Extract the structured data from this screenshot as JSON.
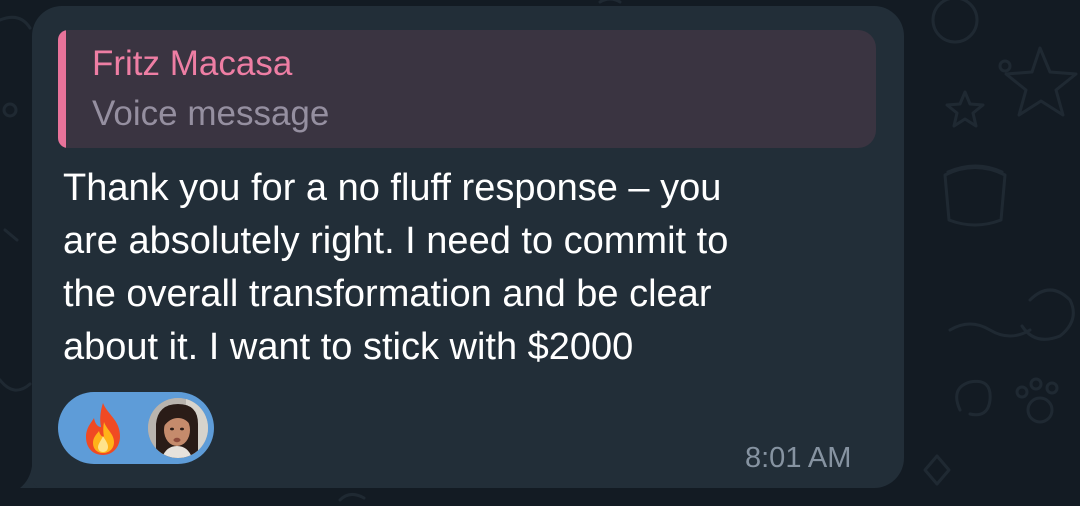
{
  "reply": {
    "sender_name": "Fritz Macasa",
    "quoted_text": "Voice message",
    "accent_color": "#ee7ea4"
  },
  "message": {
    "lines": [
      "Thank you for a no fluff response – you",
      "are absolutely right. I need to commit to",
      "the overall transformation and be clear",
      "about it. I want to stick with $2000"
    ],
    "timestamp": "8:01 AM"
  },
  "reaction": {
    "emoji": "fire-icon",
    "reactor_avatar": "avatar",
    "pill_color": "#5e9cd8"
  },
  "theme": {
    "bubble_color": "#222e38",
    "background_color": "#131b23"
  }
}
